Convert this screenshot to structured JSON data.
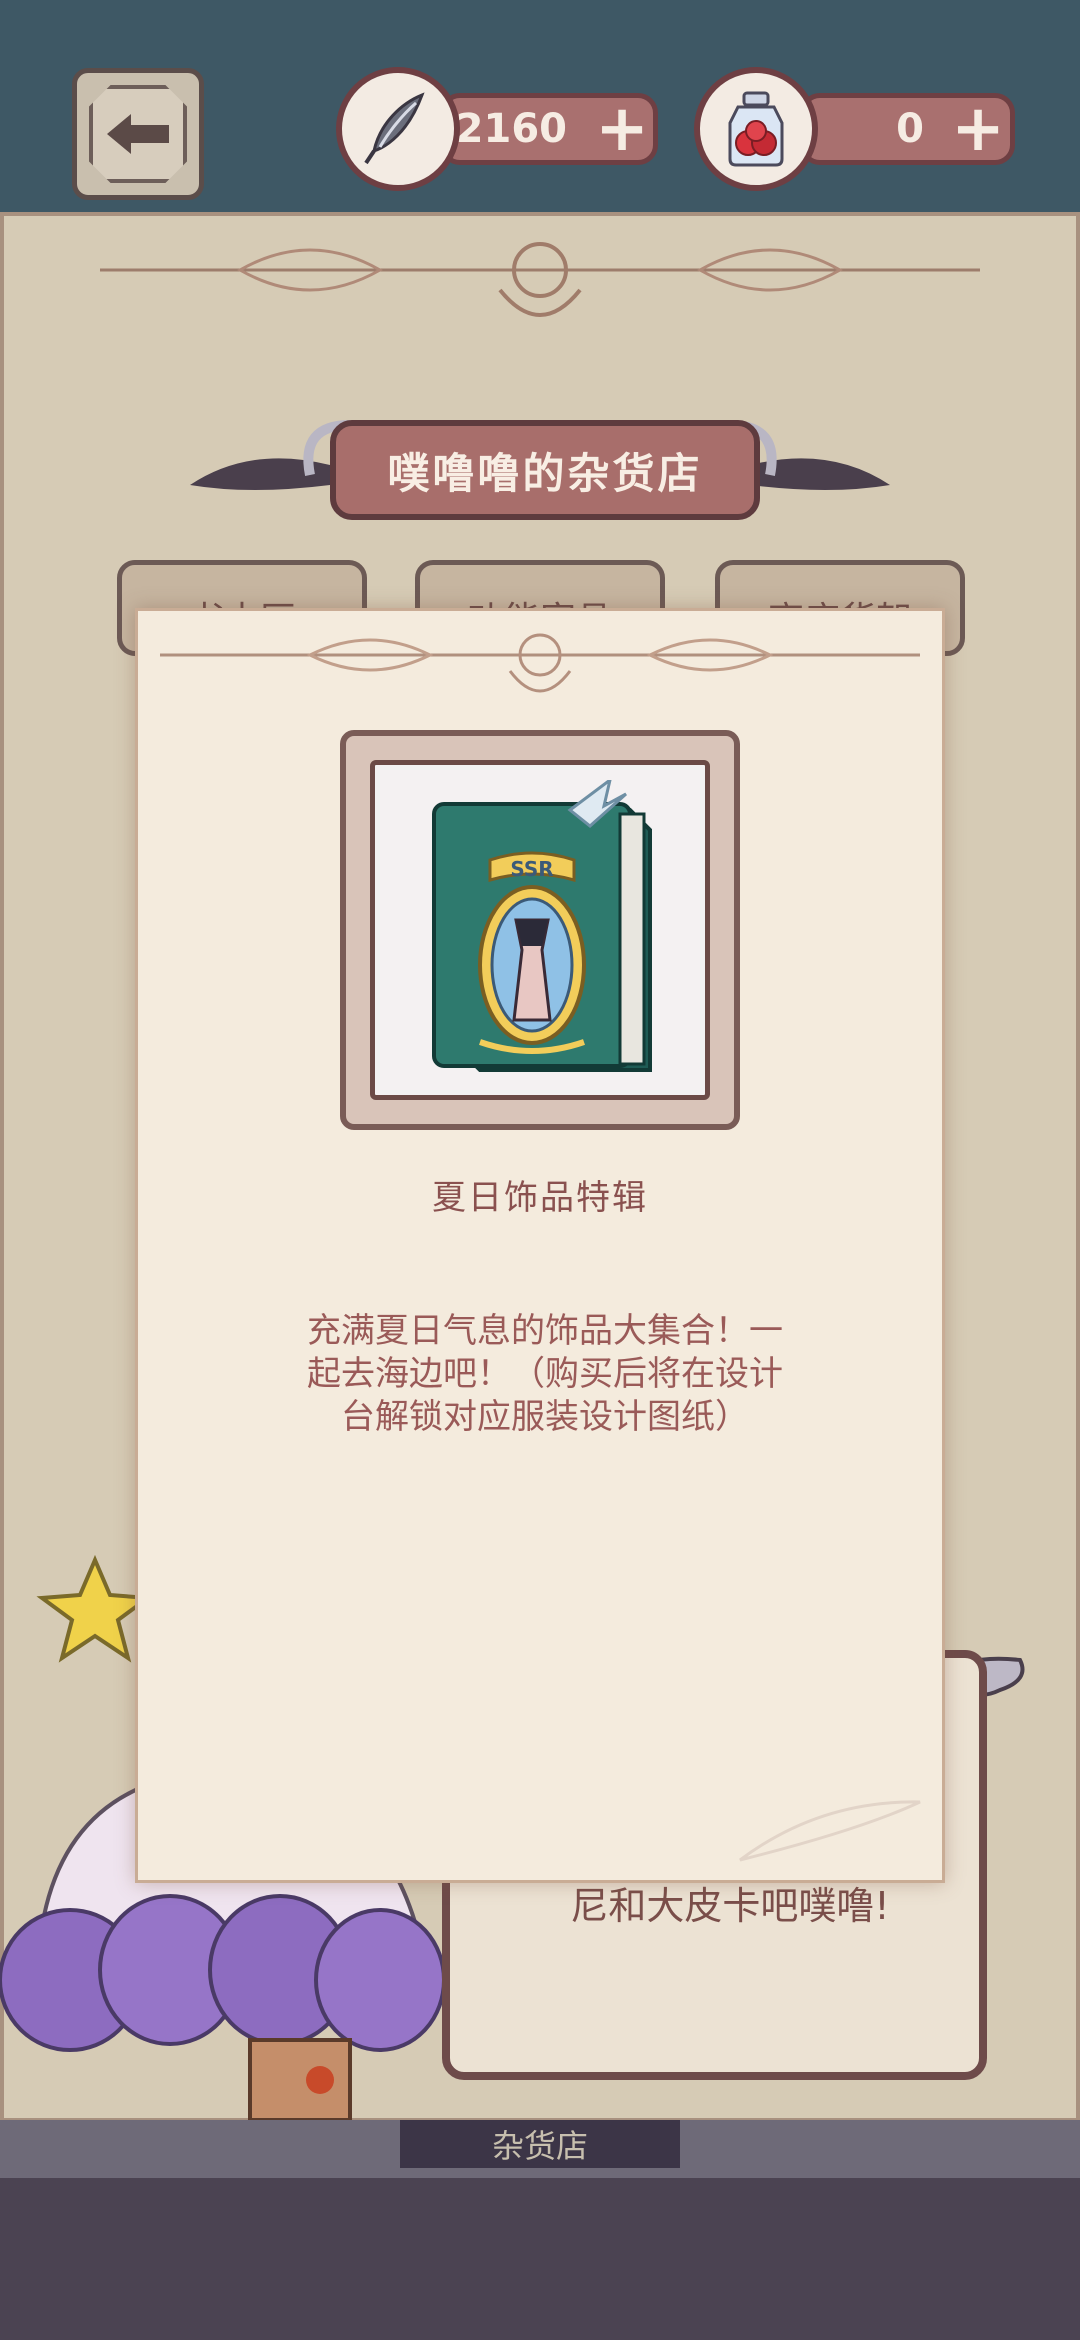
{
  "header": {
    "currency_feather": {
      "amount": "2160",
      "icon": "feather-icon"
    },
    "currency_potion": {
      "amount": "0",
      "icon": "potion-jar-icon"
    },
    "plus_symbol": "+"
  },
  "shop": {
    "title": "噗噜噜的杂货店",
    "tabs": [
      {
        "label": "书本区"
      },
      {
        "label": "功能家具"
      },
      {
        "label": "商店货架"
      }
    ],
    "bottom_sign": "杂货店",
    "character_speech": "尼和大皮卡吧噗噜!"
  },
  "popup": {
    "item_name": "夏日饰品特辑",
    "item_badge": "SSR",
    "description": "充满夏日气息的饰品大集合！一起去海边吧！（购买后将在设计台解锁对应服装设计图纸）"
  },
  "colors": {
    "background": "#3d5764",
    "panel": "#d6cbb5",
    "popup": "#f4ebdd",
    "accent_pill": "#a9706f",
    "text_brown": "#8a514f",
    "book_teal": "#2e7a6e"
  }
}
